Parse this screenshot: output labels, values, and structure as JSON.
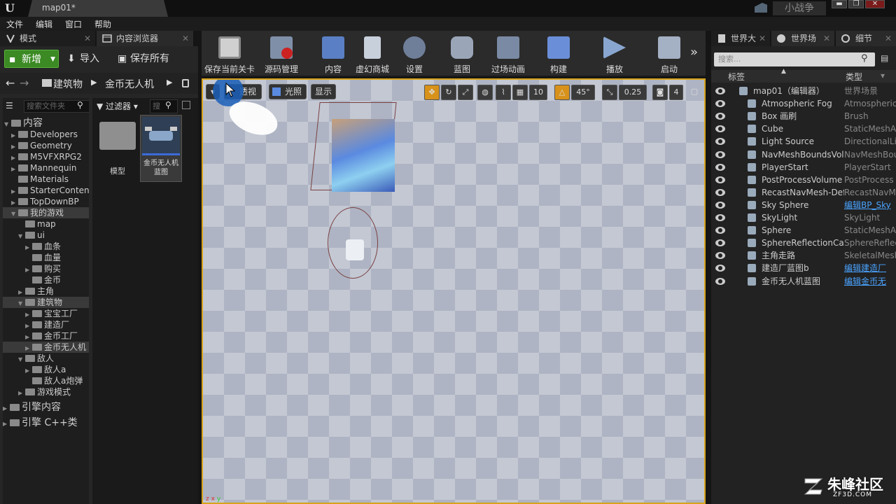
{
  "title_bar": {
    "doc_tab": "map01*",
    "user": "小战争"
  },
  "menu": [
    "文件",
    "编辑",
    "窗口",
    "帮助"
  ],
  "left_tabs": {
    "modes": "模式",
    "content_browser": "内容浏览器"
  },
  "actions": {
    "new": "新增",
    "import": "导入",
    "save_all": "保存所有"
  },
  "breadcrumb": [
    "建筑物",
    "金币无人机"
  ],
  "tree": {
    "search_placeholder": "搜索文件夹",
    "items": [
      {
        "label": "内容",
        "level": 0,
        "exp": "▼"
      },
      {
        "label": "Developers",
        "level": 1,
        "exp": "▶"
      },
      {
        "label": "Geometry",
        "level": 1,
        "exp": "▶"
      },
      {
        "label": "M5VFXRPG2",
        "level": 1,
        "exp": "▶"
      },
      {
        "label": "Mannequin",
        "level": 1,
        "exp": "▶"
      },
      {
        "label": "Materials",
        "level": 1,
        "exp": ""
      },
      {
        "label": "StarterConten",
        "level": 1,
        "exp": "▶"
      },
      {
        "label": "TopDownBP",
        "level": 1,
        "exp": "▶"
      },
      {
        "label": "我的游戏",
        "level": 1,
        "exp": "▼"
      },
      {
        "label": "map",
        "level": 2,
        "exp": ""
      },
      {
        "label": "ui",
        "level": 2,
        "exp": "▼"
      },
      {
        "label": "血条",
        "level": 3,
        "exp": "▶"
      },
      {
        "label": "血量",
        "level": 3,
        "exp": ""
      },
      {
        "label": "购买",
        "level": 3,
        "exp": "▶"
      },
      {
        "label": "金币",
        "level": 3,
        "exp": ""
      },
      {
        "label": "主角",
        "level": 2,
        "exp": "▶"
      },
      {
        "label": "建筑物",
        "level": 2,
        "exp": "▼"
      },
      {
        "label": "宝宝工厂",
        "level": 3,
        "exp": "▶"
      },
      {
        "label": "建造厂",
        "level": 3,
        "exp": "▶"
      },
      {
        "label": "金币工厂",
        "level": 3,
        "exp": "▶"
      },
      {
        "label": "金币无人机",
        "level": 3,
        "exp": "▶"
      },
      {
        "label": "敌人",
        "level": 2,
        "exp": "▼"
      },
      {
        "label": "敌人a",
        "level": 3,
        "exp": "▶"
      },
      {
        "label": "敌人a炮弹",
        "level": 3,
        "exp": ""
      },
      {
        "label": "游戏模式",
        "level": 2,
        "exp": "▶"
      }
    ],
    "engine_content": "引擎内容",
    "engine_cpp": "引擎 C++类"
  },
  "assets": {
    "filter": "过滤器",
    "search_placeholder": "搜",
    "items": [
      {
        "label": "模型"
      },
      {
        "label": "金币无人机蓝图"
      }
    ]
  },
  "toolbar": [
    "保存当前关卡",
    "源码管理",
    "内容",
    "虚幻商城",
    "设置",
    "蓝图",
    "过场动画",
    "构建",
    "播放",
    "启动"
  ],
  "viewport": {
    "perspective": "透视",
    "lighting": "光照",
    "show": "显示",
    "grid": "10",
    "angle": "45°",
    "scale": "0.25",
    "camspeed": "4"
  },
  "right_tabs": {
    "outliner": "世界大",
    "world_settings": "世界场",
    "details": "细节"
  },
  "outliner": {
    "search_placeholder": "搜索...",
    "col_label": "标签",
    "col_type": "类型",
    "rows": [
      {
        "name": "map01（编辑器）",
        "type": "世界场景",
        "link": false
      },
      {
        "name": "Atmospheric Fog",
        "type": "Atmospheric",
        "link": false
      },
      {
        "name": "Box 画刷",
        "type": "Brush",
        "link": false
      },
      {
        "name": "Cube",
        "type": "StaticMeshA",
        "link": false
      },
      {
        "name": "Light Source",
        "type": "DirectionalLi",
        "link": false
      },
      {
        "name": "NavMeshBoundsVolu",
        "type": "NavMeshBou",
        "link": false
      },
      {
        "name": "PlayerStart",
        "type": "PlayerStart",
        "link": false
      },
      {
        "name": "PostProcessVolume",
        "type": "PostProcess",
        "link": false
      },
      {
        "name": "RecastNavMesh-Defa",
        "type": "RecastNavM",
        "link": false
      },
      {
        "name": "Sky Sphere",
        "type": "编辑BP_Sky",
        "link": true
      },
      {
        "name": "SkyLight",
        "type": "SkyLight",
        "link": false
      },
      {
        "name": "Sphere",
        "type": "StaticMeshA",
        "link": false
      },
      {
        "name": "SphereReflectionCapt",
        "type": "SphereReflec",
        "link": false
      },
      {
        "name": "主角走路",
        "type": "SkeletalMesh",
        "link": false
      },
      {
        "name": "建造厂蓝图b",
        "type": "编辑建造厂",
        "link": true
      },
      {
        "name": "金币无人机蓝图",
        "type": "编辑金币无",
        "link": true
      }
    ]
  },
  "watermark": {
    "brand": "朱峰社区",
    "url": "ZF3D.COM"
  }
}
